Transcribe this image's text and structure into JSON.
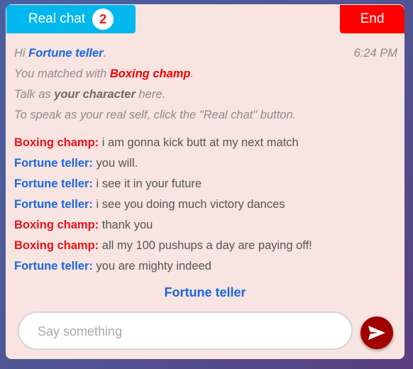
{
  "header": {
    "real_chat_label": "Real chat",
    "real_chat_count": "2",
    "end_label": "End"
  },
  "system": {
    "greeting_prefix": "Hi ",
    "user_name": "Fortune teller",
    "greeting_suffix": ".",
    "time": "6:24 PM",
    "matched_prefix": "You matched with ",
    "partner_name": "Boxing champ",
    "matched_suffix": ".",
    "talk_prefix": "Talk as ",
    "talk_bold": "your character",
    "talk_suffix": " here.",
    "real_self_hint": "To speak as your real self, click the \"Real chat\" button."
  },
  "messages": [
    {
      "sender": "Boxing champ:",
      "role": "partner",
      "text": " i am gonna kick butt at my next match"
    },
    {
      "sender": "Fortune teller:",
      "role": "self",
      "text": " you will."
    },
    {
      "sender": "Fortune teller:",
      "role": "self",
      "text": " i see it in your future"
    },
    {
      "sender": "Fortune teller:",
      "role": "self",
      "text": " i see you doing much victory dances"
    },
    {
      "sender": "Boxing champ:",
      "role": "partner",
      "text": " thank you"
    },
    {
      "sender": "Boxing champ:",
      "role": "partner",
      "text": " all my 100 pushups a day are paying off!"
    },
    {
      "sender": "Fortune teller:",
      "role": "self",
      "text": " you are mighty indeed"
    }
  ],
  "composer": {
    "current_speaker": "Fortune teller",
    "placeholder": "Say something",
    "value": ""
  },
  "icons": {
    "send": "send-arrow-icon"
  },
  "colors": {
    "real_chat": "#00b8ee",
    "end": "#ff0000",
    "self_name": "#1a66e0",
    "partner_name": "#e8121b",
    "send_button": "#a00000",
    "panel_bg": "#f8e4e0"
  }
}
